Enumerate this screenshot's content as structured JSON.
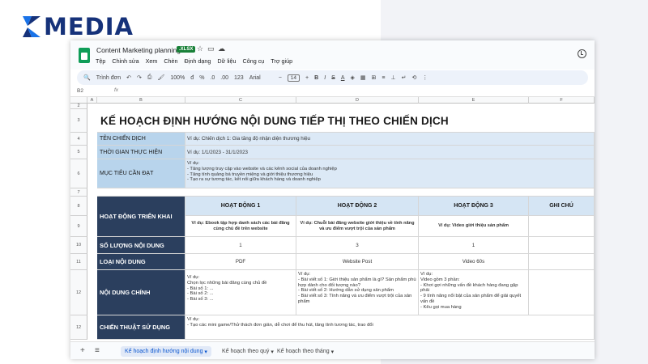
{
  "brand": {
    "name": "MEDIA",
    "color": "#16327a"
  },
  "window": {
    "doc_title": "Content Marketing planning",
    "file_badge": ".XLSX",
    "menu": [
      "Tệp",
      "Chỉnh sửa",
      "Xem",
      "Chèn",
      "Định dạng",
      "Dữ liệu",
      "Công cụ",
      "Trợ giúp"
    ]
  },
  "toolbar": {
    "search": "Trình đơn",
    "zoom": "100%",
    "currency": "đ",
    "percent": "%",
    "dec_minus": ".0",
    "dec_plus": ".00",
    "num_format": "123",
    "font": "Arial",
    "font_size": "14",
    "bold": "B",
    "italic": "I",
    "strike": "S",
    "text_color": "A"
  },
  "formula_bar": {
    "cell_ref": "B2",
    "fx": "fx"
  },
  "columns": [
    "A",
    "B",
    "C",
    "D",
    "E",
    "F"
  ],
  "rows": [
    "2",
    "3",
    "4",
    "5",
    "6",
    "7",
    "8",
    "9",
    "10",
    "11",
    "12"
  ],
  "sheet": {
    "title": "KẾ HOẠCH ĐỊNH HƯỚNG NỘI DUNG TIẾP THỊ THEO CHIẾN DỊCH",
    "campaign_label": "TÊN CHIẾN DỊCH",
    "campaign_value": "Ví dụ: Chiến dịch 1: Gia tăng độ nhận diện thương hiệu",
    "time_label": "THỜI GIAN THỰC HIỆN",
    "time_value": "Ví dụ: 1/1/2023 - 31/1/2023",
    "goal_label": "MỤC TIÊU CẦN ĐẠT",
    "goal_value": "Ví dụ:\n- Tăng lượng truy cập vào website và các kênh social của doanh nghiệp\n- Tăng tính quảng bá truyền miệng và giới thiệu thương hiệu\n- Tạo ra sự tương tác, kết nối giữa khách hàng và doanh nghiệp",
    "activity_label": "HOẠT ĐỘNG TRIỂN KHAI",
    "act1_head": "HOẠT ĐỘNG 1",
    "act2_head": "HOẠT ĐỘNG 2",
    "act3_head": "HOẠT ĐỘNG 3",
    "note_head": "GHI CHÚ",
    "act1_ex": "Ví dụ: Ebook tập hợp danh sách các bài đăng cùng chủ đề trên website",
    "act2_ex": "Ví dụ: Chuỗi bài đăng website giới thiệu về tính năng và ưu điểm vượt trội của sản phẩm",
    "act3_ex": "Ví dụ: Video giới thiệu sản phẩm",
    "qty_label": "SỐ LƯỢNG NỘI DUNG",
    "qty1": "1",
    "qty2": "3",
    "qty3": "1",
    "type_label": "LOẠI NỘI DUNG",
    "type1": "PDF",
    "type2": "Website Post",
    "type3": "Video 60s",
    "content_label": "NỘI DUNG CHÍNH",
    "content1": "Ví dụ:\nChọn lọc những bài đăng cùng chủ đề\n- Bài số 1: ...\n- Bài số 2: ...\n- Bài số 3: ...",
    "content2": "Ví dụ:\n- Bài viết số 1: Giới thiệu sản phẩm là gì? Sản phẩm phù hợp dành cho đối tượng nào?\n- Bài viết số 2: Hướng dẫn sử dụng sản phẩm\n- Bài viết số 3: Tính năng và ưu điểm vượt trội của sản phẩm",
    "content3": "Ví dụ:\nVideo gồm 3 phần:\n- Khơi gợi những vấn đề khách hàng đang gặp phải\n- 9 tính năng nổi bật của sản phẩm để giải quyết vấn đề\n- Kêu gọi mua hàng",
    "tactic_label": "CHIẾN THUẬT SỬ DỤNG",
    "tactic_value": "Ví dụ:\n- Tạo các mini game/Thử thách đơn giản, dễ chơi để thu hút, tăng tính tương tác, trao đổi"
  },
  "tabs": [
    "Kế hoạch định hướng nội dung",
    "Kế hoạch theo quý",
    "Kế hoạch theo tháng"
  ],
  "colors": {
    "navy": "#2b3f5e",
    "label_blue": "#b8d4ec",
    "sheet_green": "#0f9d58"
  }
}
